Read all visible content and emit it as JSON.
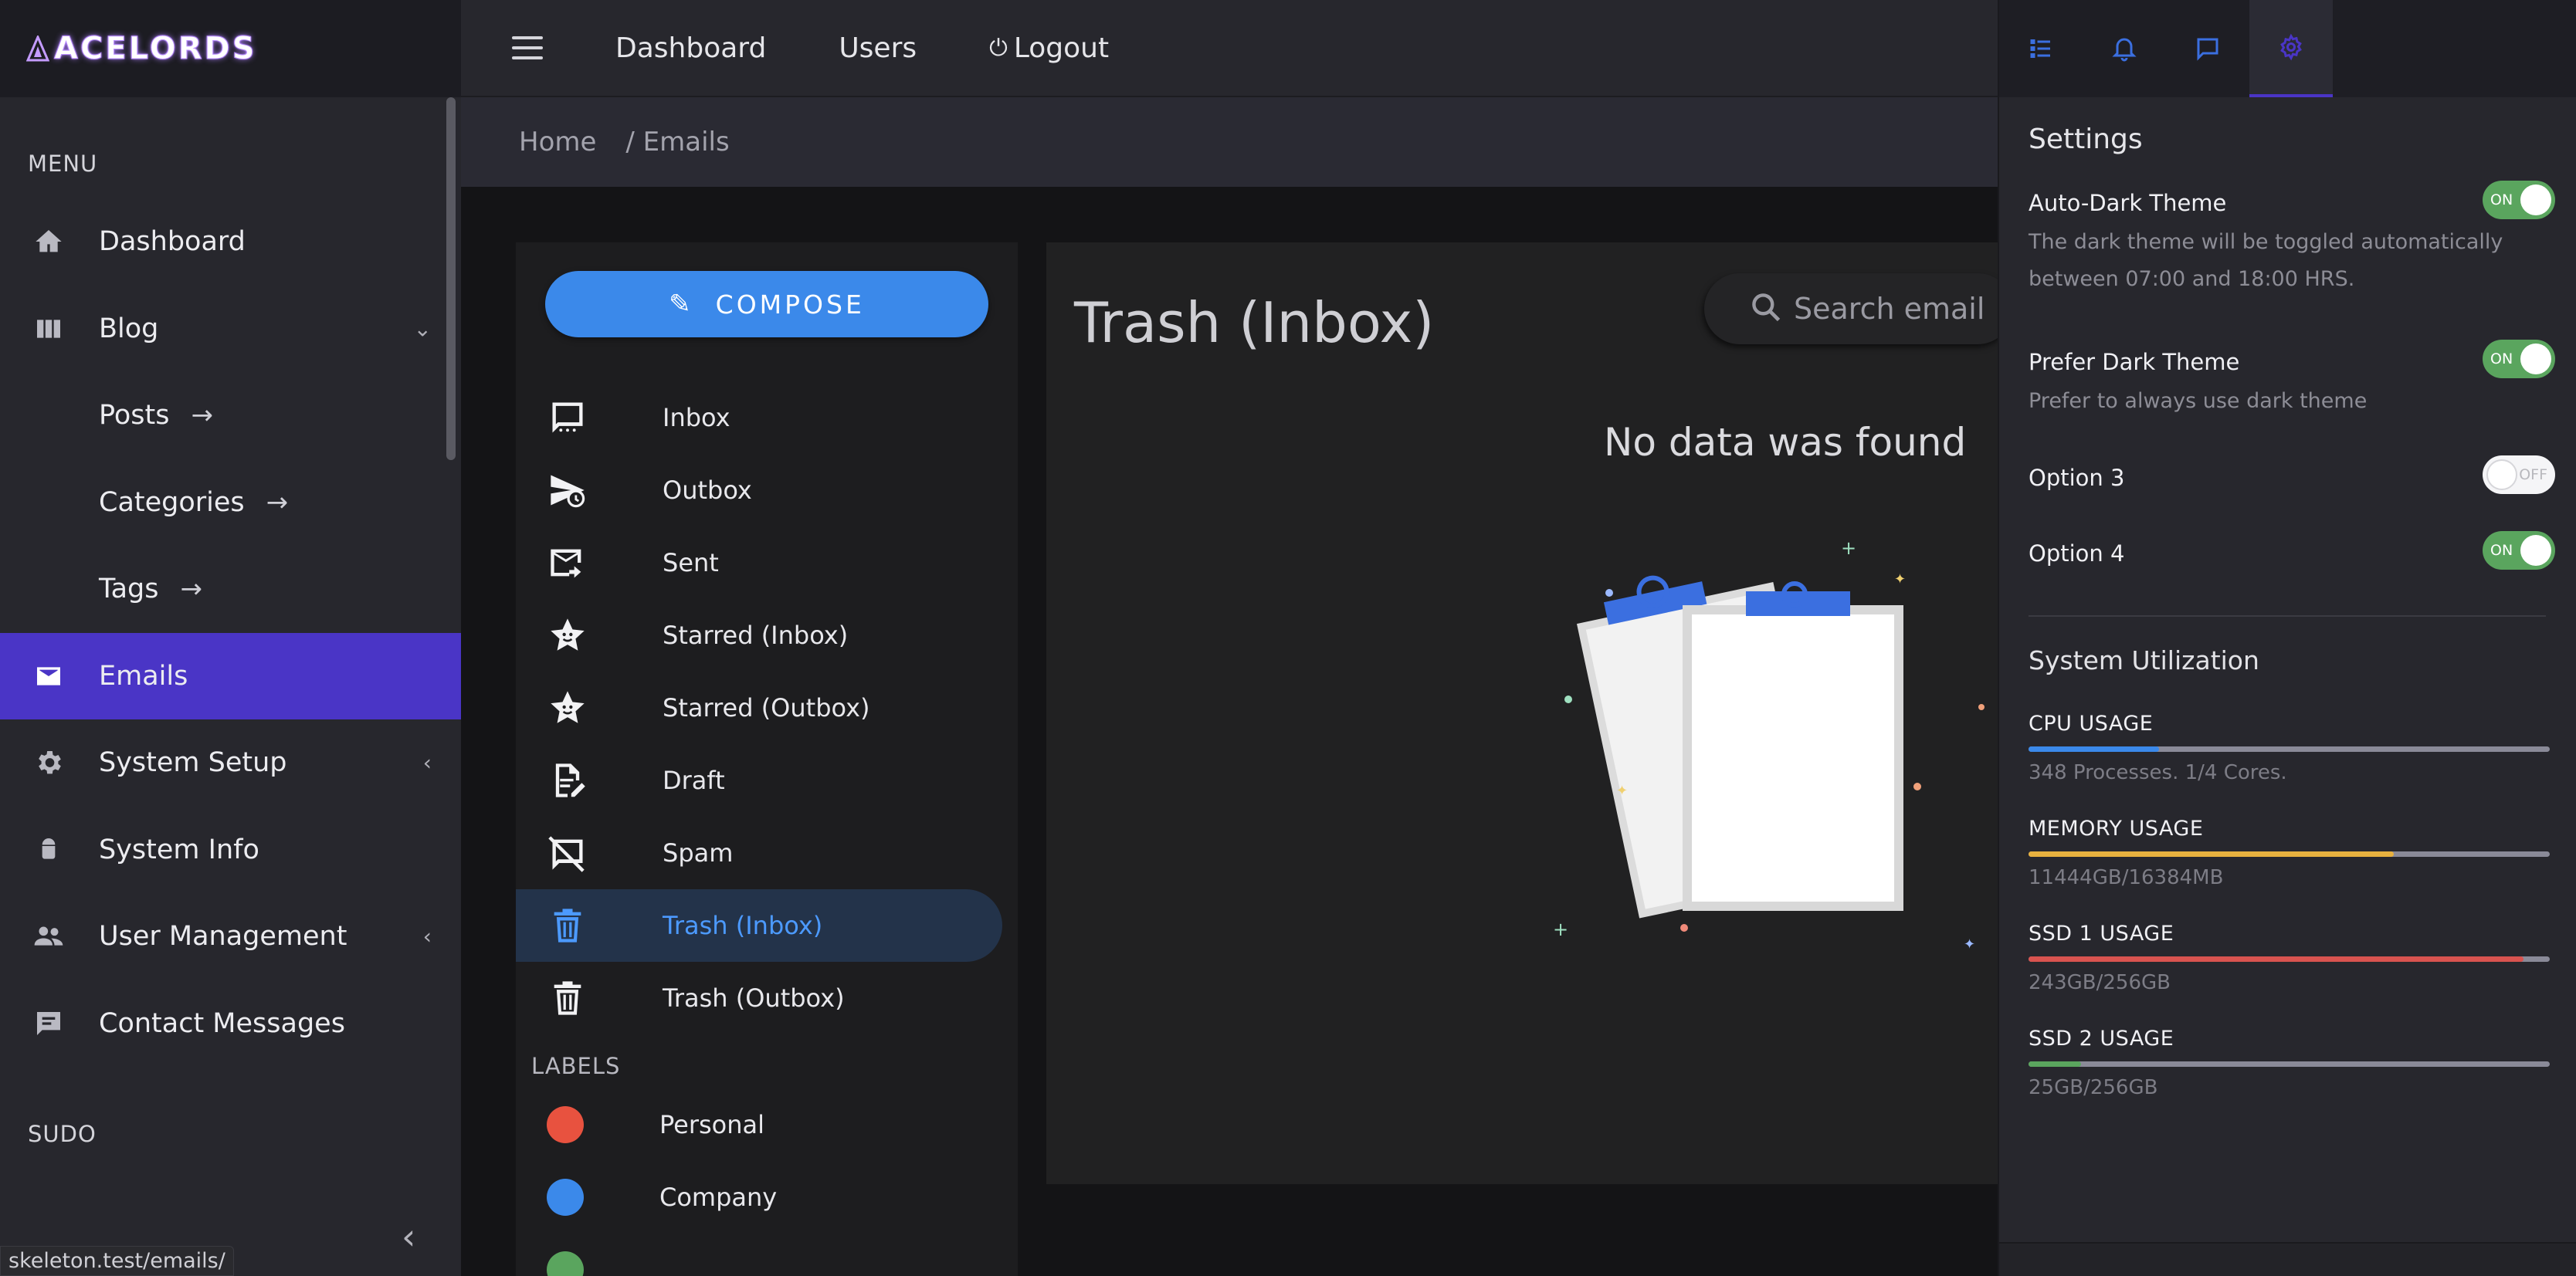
{
  "brand": {
    "name": "ACELORDS"
  },
  "sidebar": {
    "menu_heading": "MENU",
    "sudo_heading": "SUDO",
    "items": [
      {
        "label": "Dashboard",
        "icon": "home-icon"
      },
      {
        "label": "Blog",
        "icon": "grid-icon",
        "caret": "⌄"
      },
      {
        "label": "Posts",
        "sub": true,
        "arrow": "→"
      },
      {
        "label": "Categories",
        "sub": true,
        "arrow": "→"
      },
      {
        "label": "Tags",
        "sub": true,
        "arrow": "→"
      },
      {
        "label": "Emails",
        "icon": "mail-icon",
        "active": true
      },
      {
        "label": "System Setup",
        "icon": "gear-icon",
        "caret": "‹"
      },
      {
        "label": "System Info",
        "icon": "android-icon"
      },
      {
        "label": "User Management",
        "icon": "users-icon",
        "caret": "‹"
      },
      {
        "label": "Contact Messages",
        "icon": "chat-icon"
      }
    ],
    "collapse_glyph": "‹"
  },
  "topbar": {
    "links": [
      "Dashboard",
      "Users",
      "Logout"
    ],
    "logout_glyph": "⏻"
  },
  "breadcrumb": {
    "home": "Home",
    "current": "/ Emails"
  },
  "mail": {
    "compose_label": "COMPOSE",
    "folders": [
      {
        "label": "Inbox",
        "icon": "inbox-icon"
      },
      {
        "label": "Outbox",
        "icon": "outbox-icon"
      },
      {
        "label": "Sent",
        "icon": "sent-icon"
      },
      {
        "label": "Starred (Inbox)",
        "icon": "star-icon"
      },
      {
        "label": "Starred (Outbox)",
        "icon": "star-icon"
      },
      {
        "label": "Draft",
        "icon": "draft-icon"
      },
      {
        "label": "Spam",
        "icon": "spam-icon"
      },
      {
        "label": "Trash (Inbox)",
        "icon": "trash-icon",
        "active": true
      },
      {
        "label": "Trash (Outbox)",
        "icon": "trash-icon"
      }
    ],
    "labels_heading": "LABELS",
    "labels": [
      {
        "label": "Personal",
        "color": "#e8523f"
      },
      {
        "label": "Company",
        "color": "#3b89ea"
      },
      {
        "label": "",
        "color": "#5aa55e"
      }
    ]
  },
  "content": {
    "title": "Trash (Inbox)",
    "search_placeholder": "Search email",
    "empty_text": "No data was found"
  },
  "settings": {
    "tabs": [
      "list-icon",
      "bell-icon",
      "message-icon",
      "gear-icon"
    ],
    "title": "Settings",
    "options": [
      {
        "label": "Auto-Dark Theme",
        "desc": "The dark theme will be toggled automatically between 07:00 and 18:00 HRS.",
        "state": "ON"
      },
      {
        "label": "Prefer Dark Theme",
        "desc": "Prefer to always use dark theme",
        "state": "ON"
      },
      {
        "label": "Option 3",
        "desc": "",
        "state": "OFF"
      },
      {
        "label": "Option 4",
        "desc": "",
        "state": "ON"
      }
    ],
    "utilization_title": "System Utilization",
    "meters": [
      {
        "label": "CPU USAGE",
        "note": "348 Processes. 1/4 Cores.",
        "fraction": 0.25,
        "color": "#3b89ea"
      },
      {
        "label": "MEMORY USAGE",
        "note": "11444GB/16384MB",
        "fraction": 0.7,
        "color": "#e8b13f"
      },
      {
        "label": "SSD 1 USAGE",
        "note": "243GB/256GB",
        "fraction": 0.95,
        "color": "#d9534f"
      },
      {
        "label": "SSD 2 USAGE",
        "note": "25GB/256GB",
        "fraction": 0.1,
        "color": "#5aa55e"
      }
    ]
  },
  "status_bar": {
    "url": "skeleton.test/emails/"
  }
}
